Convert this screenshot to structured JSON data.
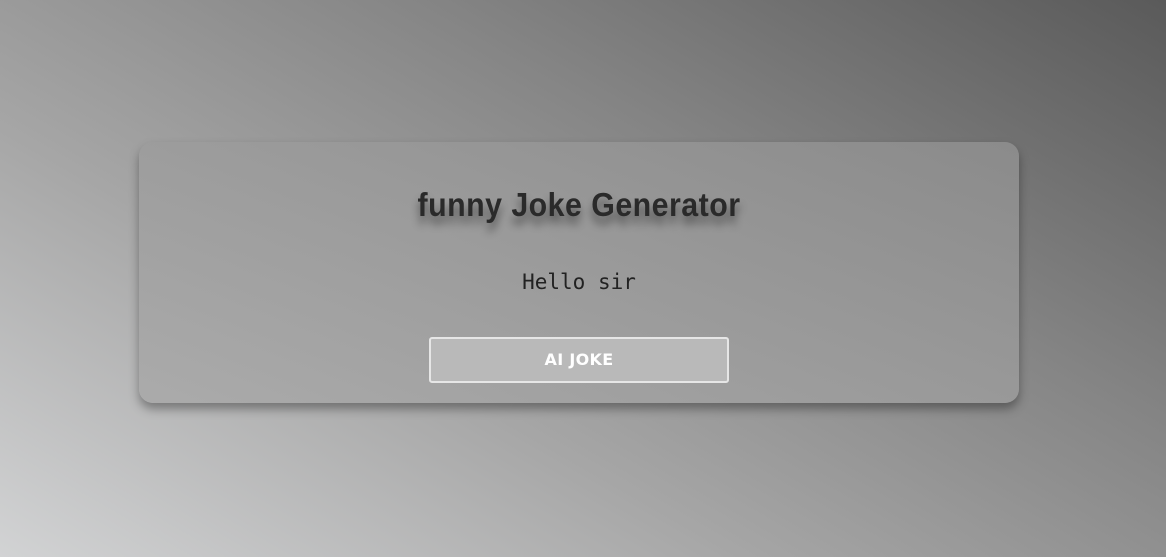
{
  "app": {
    "title": "funny Joke Generator",
    "joke_text": "Hello sir",
    "button_label": "AI JOKE"
  },
  "colors": {
    "title_text": "#2a2a2a",
    "button_background": "#b9b9b9",
    "button_text": "#ffffff"
  }
}
